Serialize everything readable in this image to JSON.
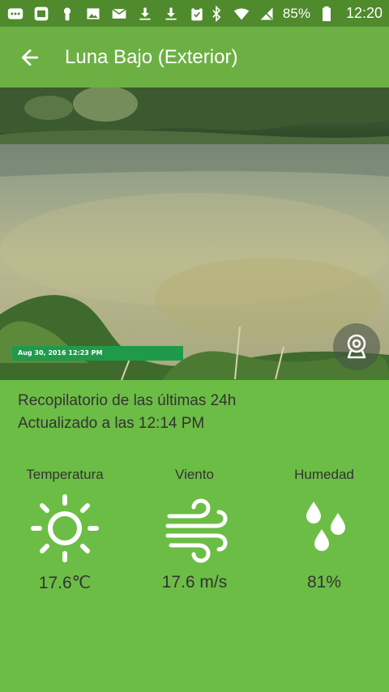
{
  "status_bar": {
    "battery_percent": "85%",
    "time": "12:20",
    "left_icons": [
      "chat-icon",
      "calendar-icon",
      "gear-badge-icon",
      "image-icon",
      "mail-icon",
      "download-icon",
      "download-icon",
      "clipboard-icon"
    ],
    "right_icons": [
      "bluetooth-icon",
      "wifi-icon",
      "no-signal-icon",
      "battery-icon"
    ]
  },
  "app_bar": {
    "title": "Luna Bajo (Exterior)",
    "back_icon": "arrow-left-icon"
  },
  "webcam": {
    "timestamp": "Aug 30, 2016 12:23 PM",
    "camera_button_icon": "webcam-icon"
  },
  "summary": {
    "line1": "Recopilatorio de las últimas 24h",
    "line2": "Actualizado a las 12:14 PM"
  },
  "stats": {
    "temperature": {
      "label": "Temperatura",
      "value": "17.6℃",
      "icon": "sun-icon"
    },
    "wind": {
      "label": "Viento",
      "value": "17.6 m/s",
      "icon": "wind-icon"
    },
    "humidity": {
      "label": "Humedad",
      "value": "81%",
      "icon": "droplets-icon"
    }
  },
  "colors": {
    "status_bar": "#4f8a2c",
    "app_bar": "#6cb043",
    "background": "#6cbd45",
    "timestamp_bg": "#1f9a4b",
    "text": "#333333"
  }
}
